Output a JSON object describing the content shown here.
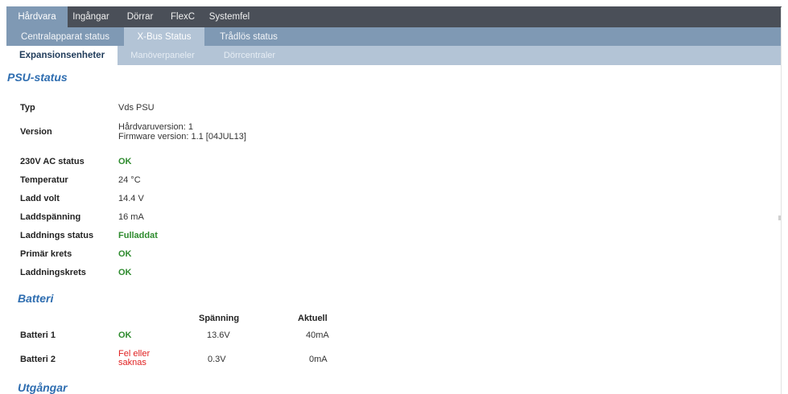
{
  "tabs_level1": [
    "Hårdvara",
    "Ingångar",
    "Dörrar",
    "FlexC",
    "Systemfel"
  ],
  "tabs_level2": [
    "Centralapparat status",
    "X-Bus Status",
    "Trådlös status"
  ],
  "tabs_level3": [
    "Expansionsenheter",
    "Manöverpaneler",
    "Dörrcentraler"
  ],
  "psu": {
    "title": "PSU-status",
    "typ_label": "Typ",
    "typ_value": "Vds PSU",
    "version_label": "Version",
    "version_hw": "Hårdvaruversion: 1",
    "version_fw": "Firmware version: 1.1 [04JUL13]",
    "ac_label": "230V AC status",
    "ac_value": "OK",
    "temp_label": "Temperatur",
    "temp_value": "24 °C",
    "laddvolt_label": "Ladd volt",
    "laddvolt_value": "14.4 V",
    "laddspanning_label": "Laddspänning",
    "laddspanning_value": "16 mA",
    "laddstatus_label": "Laddnings status",
    "laddstatus_value": "Fulladdat",
    "primar_label": "Primär krets",
    "primar_value": "OK",
    "laddkrets_label": "Laddningskrets",
    "laddkrets_value": "OK"
  },
  "batteri": {
    "title": "Batteri",
    "col_spanning": "Spänning",
    "col_aktuell": "Aktuell",
    "rows": [
      {
        "name": "Batteri 1",
        "status": "OK",
        "spanning": "13.6V",
        "aktuell": "40mA"
      },
      {
        "name": "Batteri 2",
        "status_line1": "Fel eller",
        "status_line2": "saknas",
        "spanning": "0.3V",
        "aktuell": "0mA"
      }
    ]
  },
  "utgangar": {
    "title": "Utgångar"
  },
  "colors": {
    "tabbar_dark": "#4a4f58",
    "tabbar_mid": "#7f99b4",
    "tabbar_light": "#b3c4d6",
    "heading": "#2e6db0",
    "ok": "#2e8b2e",
    "error": "#e02020"
  }
}
